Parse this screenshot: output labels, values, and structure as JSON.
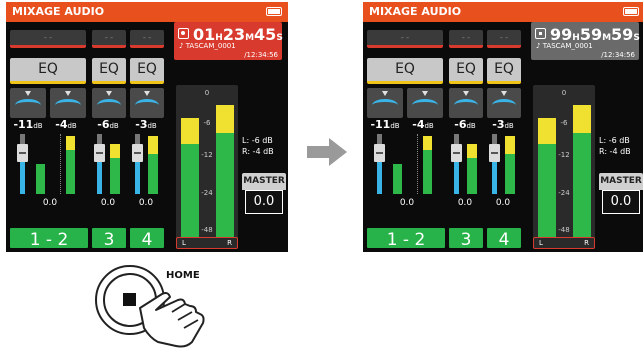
{
  "left_screen": {
    "header_title": "MIXAGE AUDIO",
    "slot_label": "- -",
    "eq_labels": [
      "EQ",
      "EQ",
      "EQ"
    ],
    "channel_levels": [
      "-11",
      "-4",
      "-6",
      "-3"
    ],
    "level_unit": "dB",
    "fader_values": [
      "0.0",
      "0.0",
      "0.0"
    ],
    "channel_buttons": [
      "1 - 2",
      "3",
      "4"
    ],
    "record_time": {
      "hh": "01",
      "h": "H",
      "mm": "23",
      "m": "M",
      "ss": "45",
      "s": "S"
    },
    "file_name": "TASCAM_0001",
    "remaining": "/12:34:56",
    "meter_ticks": [
      "0",
      "-6",
      "-12",
      "-24",
      "-48"
    ],
    "lr_labels": [
      "L",
      "R"
    ],
    "level_readout": [
      "L: -6 dB",
      "R: -4 dB"
    ],
    "master_label": "MASTER",
    "master_value": "0.0"
  },
  "right_screen": {
    "header_title": "MIXAGE AUDIO",
    "slot_label": "- -",
    "eq_labels": [
      "EQ",
      "EQ",
      "EQ"
    ],
    "channel_levels": [
      "-11",
      "-4",
      "-6",
      "-3"
    ],
    "level_unit": "dB",
    "fader_values": [
      "0.0",
      "0.0",
      "0.0"
    ],
    "channel_buttons": [
      "1 - 2",
      "3",
      "4"
    ],
    "record_time": {
      "hh": "99",
      "h": "H",
      "mm": "59",
      "m": "M",
      "ss": "59",
      "s": "S"
    },
    "file_name": "TASCAM_0001",
    "remaining": "/12:34:56",
    "meter_ticks": [
      "0",
      "-6",
      "-12",
      "-24",
      "-48"
    ],
    "lr_labels": [
      "L",
      "R"
    ],
    "level_readout": [
      "L: -6 dB",
      "R: -4 dB"
    ],
    "master_label": "MASTER",
    "master_value": "0.0"
  },
  "home_label": "HOME",
  "colors": {
    "header": "#e8501d",
    "record_active": "#d83a2e",
    "record_idle": "#6a6a6a",
    "channel_green": "#27b34a",
    "knob_blue": "#3ab4e6",
    "meter_yellow": "#f0e030",
    "meter_green": "#2fb84a"
  }
}
